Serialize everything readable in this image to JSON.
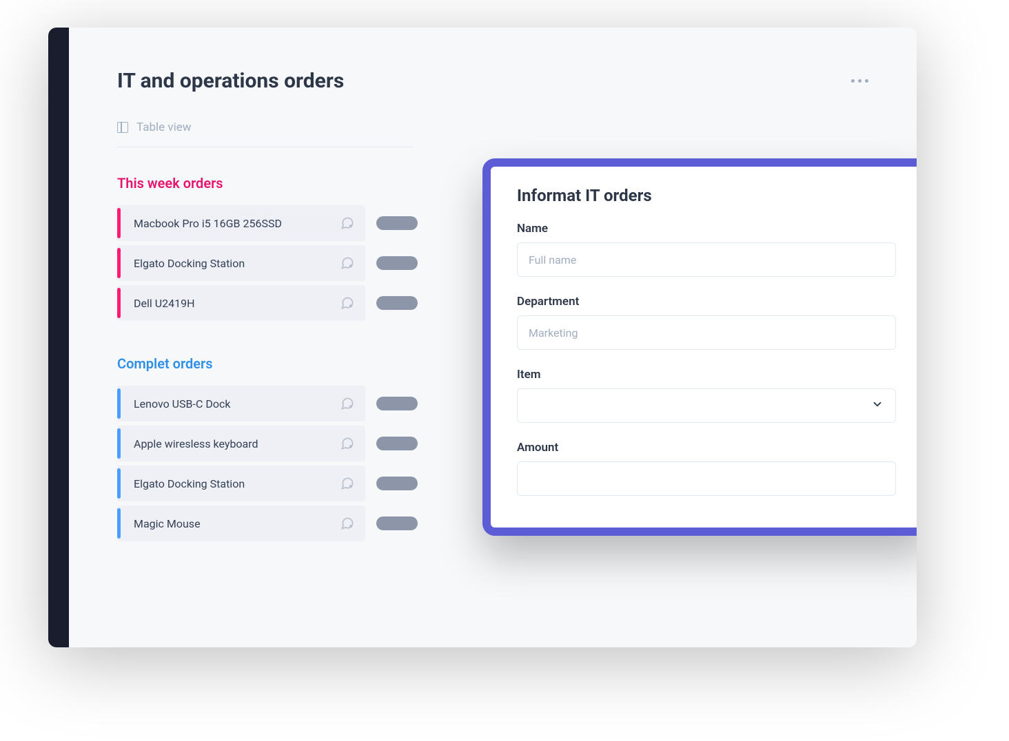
{
  "page": {
    "title": "IT and operations orders"
  },
  "tabs": {
    "table_view": "Table view"
  },
  "groups": {
    "this_week": {
      "title": "This week orders",
      "items": [
        {
          "name": "Macbook Pro i5 16GB 256SSD"
        },
        {
          "name": "Elgato Docking Station"
        },
        {
          "name": "Dell U2419H"
        }
      ]
    },
    "completed": {
      "title": "Complet orders",
      "items": [
        {
          "name": "Lenovo USB-C Dock"
        },
        {
          "name": "Apple wiresless keyboard"
        },
        {
          "name": "Elgato Docking Station"
        },
        {
          "name": "Magic Mouse"
        }
      ]
    }
  },
  "form": {
    "title": "Informat IT orders",
    "name": {
      "label": "Name",
      "placeholder": "Full name"
    },
    "department": {
      "label": "Department",
      "placeholder": "Marketing"
    },
    "item": {
      "label": "Item"
    },
    "amount": {
      "label": "Amount"
    }
  }
}
